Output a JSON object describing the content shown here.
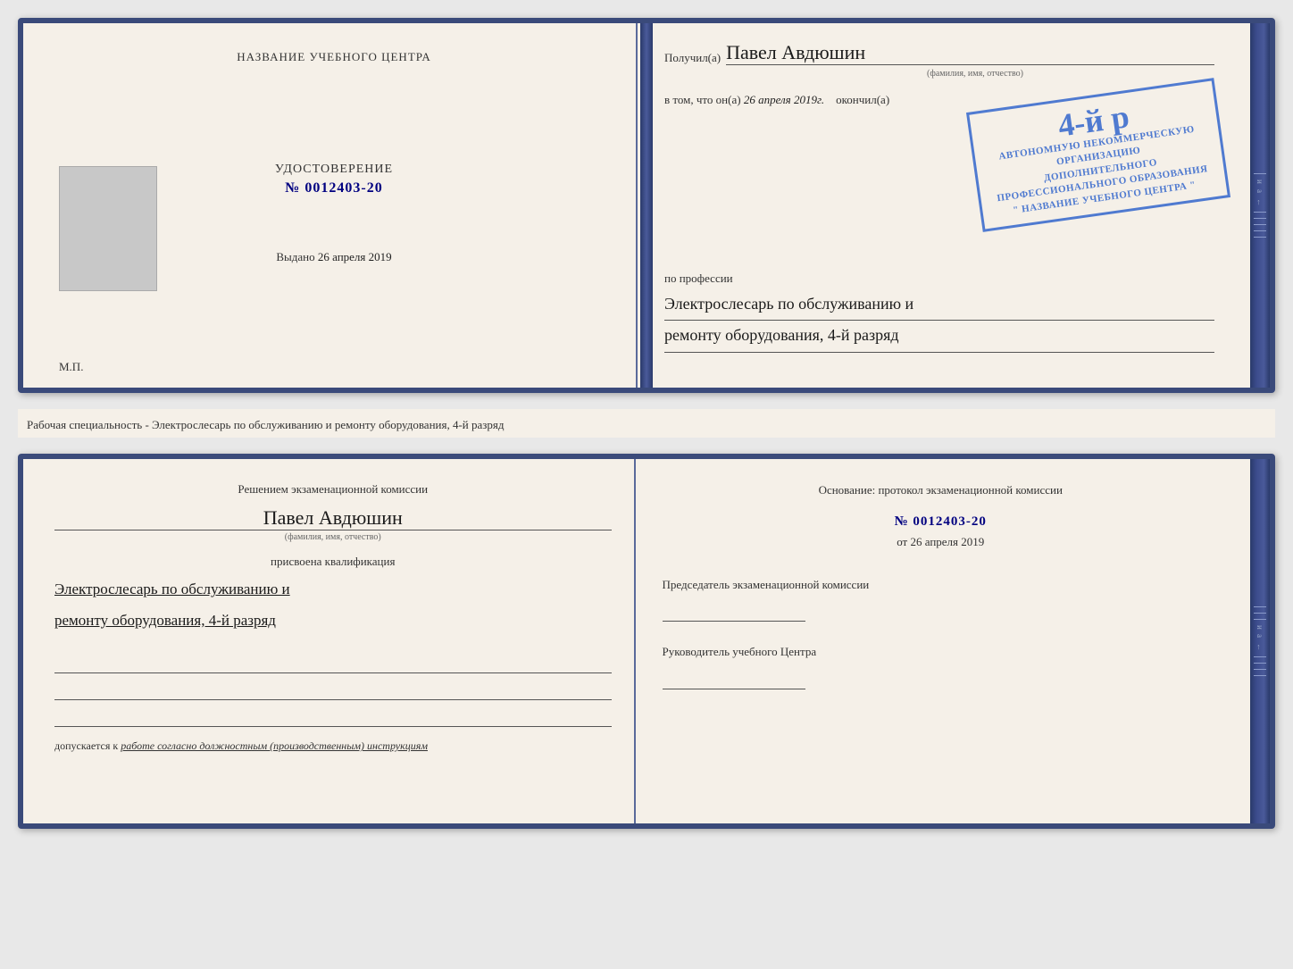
{
  "top_doc": {
    "left": {
      "center_title": "НАЗВАНИЕ УЧЕБНОГО ЦЕНТРА",
      "udostoverenie_label": "УДОСТОВЕРЕНИЕ",
      "udostoverenie_number": "№ 0012403-20",
      "vydano_prefix": "Выдано",
      "vydano_date": "26 апреля 2019",
      "mp_label": "М.П."
    },
    "right": {
      "poluchil_prefix": "Получил(а)",
      "poluchil_name": "Павел Авдюшин",
      "fio_hint": "(фамилия, имя, отчество)",
      "vtom_prefix": "в том, что он(а)",
      "vtom_date": "26 апреля 2019г.",
      "okonchil": "окончил(а)",
      "stamp_line1": "4-й р",
      "stamp_org1": "АВТОНОМНУЮ НЕКОММЕРЧЕСКУЮ ОРГАНИЗАЦИЮ",
      "stamp_org2": "ДОПОЛНИТЕЛЬНОГО ПРОФЕССИОНАЛЬНОГО ОБРАЗОВАНИЯ",
      "stamp_org3": "\" НАЗВАНИЕ УЧЕБНОГО ЦЕНТРА \"",
      "po_professii_label": "по профессии",
      "prof_line1": "Электрослесарь по обслуживанию и",
      "prof_line2": "ремонту оборудования, 4-й разряд"
    }
  },
  "separator": {
    "text": "Рабочая специальность - Электрослесарь по обслуживанию и ремонту оборудования, 4-й разряд"
  },
  "bottom_doc": {
    "left": {
      "resheniem_text": "Решением экзаменационной комиссии",
      "name": "Павел Авдюшин",
      "fio_hint": "(фамилия, имя, отчество)",
      "prisvoena_text": "присвоена квалификация",
      "qual_line1": "Электрослесарь по обслуживанию и",
      "qual_line2": "ремонту оборудования, 4-й разряд",
      "dopuskaetsya_prefix": "допускается к",
      "dopuskaetsya_italic": "работе согласно должностным (производственным) инструкциям"
    },
    "right": {
      "osnovanie_text": "Основание: протокол экзаменационной комиссии",
      "number_label": "№ 0012403-20",
      "ot_prefix": "от",
      "ot_date": "26 апреля 2019",
      "predsedatel_text": "Председатель экзаменационной комиссии",
      "rukovoditel_text": "Руководитель учебного Центра"
    }
  },
  "side_chars": [
    "и",
    "а",
    "←",
    "–",
    "–",
    "–",
    "–",
    "–"
  ]
}
